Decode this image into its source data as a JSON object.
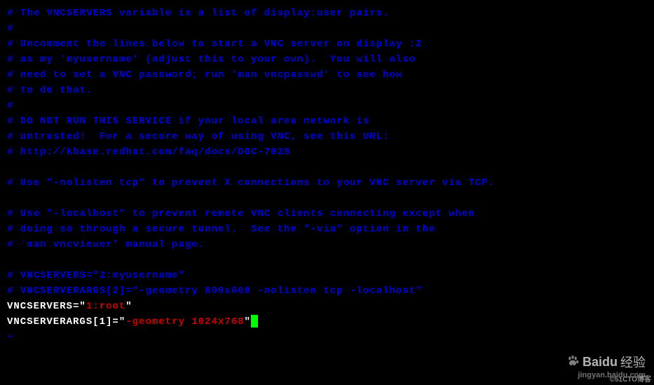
{
  "lines": {
    "c1": "# The VNCSERVERS variable is a list of display:user pairs.",
    "c2": "#",
    "c3": "# Uncomment the lines below to start a VNC server on display :2",
    "c4": "# as my 'myusername' (adjust this to your own).  You will also",
    "c5": "# need to set a VNC password; run 'man vncpasswd' to see how",
    "c6": "# to do that.",
    "c7": "#",
    "c8": "# DO NOT RUN THIS SERVICE if your local area network is",
    "c9": "# untrusted!  For a secure way of using VNC, see this URL:",
    "c10": "# http://kbase.redhat.com/faq/docs/DOC-7028",
    "c11": "",
    "c12": "# Use \"-nolisten tcp\" to prevent X connections to your VNC server via TCP.",
    "c13": "",
    "c14": "# Use \"-localhost\" to prevent remote VNC clients connecting except when",
    "c15": "# doing so through a secure tunnel.  See the \"-via\" option in the",
    "c16": "# `man vncviewer' manual page.",
    "c17": "",
    "c18": "# VNCSERVERS=\"2:myusername\"",
    "c19": "# VNCSERVERARGS[2]=\"-geometry 800x600 -nolisten tcp -localhost\"",
    "l1_a": "VNCSERVERS=\"",
    "l1_b": "1:root",
    "l1_c": "\"",
    "l2_a": "VNCSERVERARGS[1]=\"",
    "l2_b": "-geometry 1024x768",
    "l2_c": "\"",
    "tilde": "~"
  },
  "watermark": {
    "brand": "Baidu",
    "sub1": "经验",
    "sub2": "jingyan.baidu.com",
    "attrib": "©51CTO博客"
  }
}
